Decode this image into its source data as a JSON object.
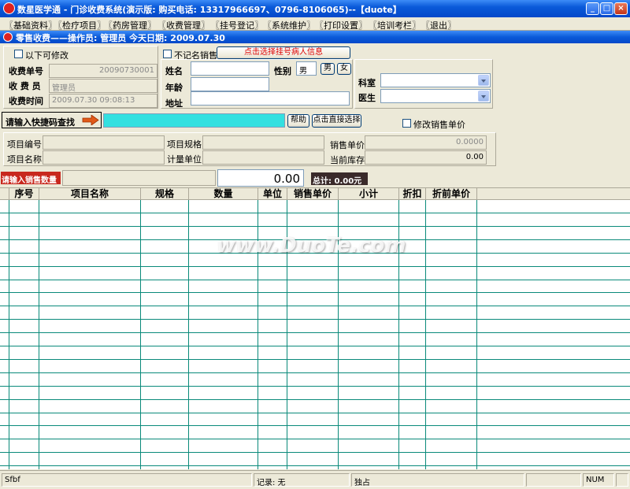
{
  "window": {
    "title": "数星医学通 - 门诊收费系统(演示版: 购买电话: 13317966697、0796-8106065)--【duote】"
  },
  "menu": [
    "〖基础资料〗",
    "〖检疗项目〗",
    "〖药房管理〗",
    "〖收费管理〗",
    "〖挂号登记〗",
    "〖系统维护〗",
    "〖打印设置〗",
    "〖培训考栏〗",
    "〖退出〗"
  ],
  "subtitle": "零售收费——操作员: 管理员   今天日期: 2009.07.30",
  "top": {
    "editable_label": "以下可修改",
    "receipt_no_label": "收费单号",
    "receipt_no": "20090730001",
    "cashier_label": "收 费 员",
    "cashier": "管理员",
    "time_label": "收费时间",
    "time": "2009.07.30 09:08:13",
    "anon_label": "不记名销售",
    "select_patient_btn": "点击选择挂号病人信息",
    "name_label": "姓名",
    "gender_label": "性别",
    "gender_value": "男",
    "male_btn": "男",
    "female_btn": "女",
    "age_label": "年龄",
    "address_label": "地址",
    "dept_label": "科室",
    "doctor_label": "医生"
  },
  "search": {
    "label": "请输入快捷码查找",
    "help_btn": "帮助",
    "direct_btn": "点击直接选择",
    "modify_price_label": "修改销售单价"
  },
  "item": {
    "code_label": "项目编号",
    "spec_label": "项目规格",
    "price_label": "销售单价",
    "price_value": "0.0000",
    "name_label": "项目名称",
    "unit_label": "计量单位",
    "stock_label": "当前库存",
    "stock_value": "0.00"
  },
  "qty": {
    "label": "请输入销售数量",
    "value": "0.00",
    "total": "总计: 0.00元"
  },
  "grid": {
    "headers": [
      "序号",
      "项目名称",
      "规格",
      "数量",
      "单位",
      "销售单价",
      "小计",
      "折扣",
      "折前单价"
    ]
  },
  "watermark": "www.DuoTe.com",
  "status": {
    "left": "Sfbf",
    "record": "记录: 无",
    "mode": "独占",
    "num": "NUM"
  }
}
